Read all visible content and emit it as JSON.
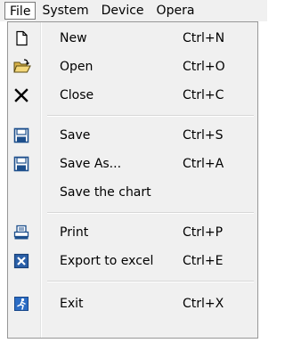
{
  "menubar": {
    "items": [
      {
        "label": "File"
      },
      {
        "label": "System"
      },
      {
        "label": "Device"
      },
      {
        "label": "Opera"
      }
    ]
  },
  "file_menu": {
    "items": [
      {
        "label": "New",
        "shortcut": "Ctrl+N",
        "icon": "new-file-icon"
      },
      {
        "label": "Open",
        "shortcut": "Ctrl+O",
        "icon": "open-folder-icon"
      },
      {
        "label": "Close",
        "shortcut": "Ctrl+C",
        "icon": "close-icon"
      },
      {
        "label": "Save",
        "shortcut": "Ctrl+S",
        "icon": "save-icon"
      },
      {
        "label": "Save As...",
        "shortcut": "Ctrl+A",
        "icon": "save-as-icon"
      },
      {
        "label": "Save the chart",
        "shortcut": ""
      },
      {
        "label": "Print",
        "shortcut": "Ctrl+P",
        "icon": "print-icon"
      },
      {
        "label": "Export to excel",
        "shortcut": "Ctrl+E",
        "icon": "excel-icon"
      },
      {
        "label": "Exit",
        "shortcut": "Ctrl+X",
        "icon": "exit-icon"
      }
    ]
  }
}
